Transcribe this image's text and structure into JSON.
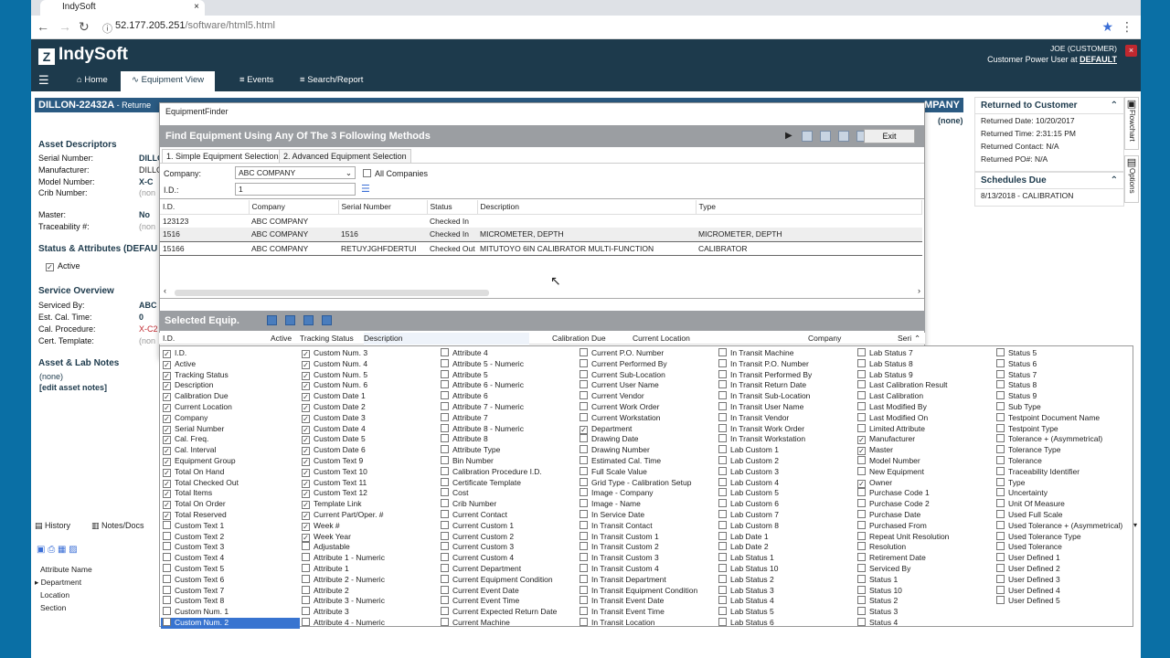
{
  "browser": {
    "tab_title": "IndySoft",
    "tab_close": "×",
    "url_host": "52.177.205.251",
    "url_path": "/software/html5.html"
  },
  "app": {
    "logo": "IndySoft",
    "user_name": "JOE (CUSTOMER)",
    "user_role": "Customer Power User at",
    "user_org": "DEFAULT",
    "close": "×"
  },
  "nav": [
    {
      "label": "Home"
    },
    {
      "label": "Equipment View"
    },
    {
      "label": "Events"
    },
    {
      "label": "Search/Report"
    }
  ],
  "banner": {
    "title": "DILLON-22432A",
    "sub": " - Returne",
    "right": "MPANY",
    "none": "(none)"
  },
  "left": {
    "asset_descriptors": "Asset Descriptors",
    "serial_lbl": "Serial Number:",
    "serial_val": "DILLO",
    "manufacturer_lbl": "Manufacturer:",
    "manufacturer_val": "DILLO",
    "model_lbl": "Model Number:",
    "model_val": "X-C",
    "crib_lbl": "Crib Number:",
    "crib_val": "(non",
    "master_lbl": "Master:",
    "master_val": "No",
    "trace_lbl": "Traceability #:",
    "trace_val": "(non",
    "status_sect": "Status & Attributes (DEFAU",
    "active": "Active",
    "service_sect": "Service Overview",
    "serviced_lbl": "Serviced By:",
    "serviced_val": "ABC",
    "estcal_lbl": "Est. Cal. Time:",
    "estcal_val": "0",
    "calproc_lbl": "Cal. Procedure:",
    "calproc_val": "X-C2",
    "cert_lbl": "Cert. Template:",
    "cert_val": "(non",
    "notes_sect": "Asset & Lab Notes",
    "notes_none": "(none)",
    "edit_notes": "[edit asset notes]",
    "history": "History",
    "notes_docs": "Notes/Docs",
    "attr_name": "Attribute Name",
    "attrs": [
      "Department",
      "Location",
      "Section"
    ]
  },
  "right": {
    "returned_hd": "Returned to Customer",
    "returned_rows": [
      "Returned Date:  10/20/2017",
      "Returned Time:  2:31:15 PM",
      "Returned Contact:  N/A",
      "Returned PO#:  N/A"
    ],
    "sched_hd": "Schedules Due",
    "sched_rows": [
      "8/13/2018 - CALIBRATION"
    ],
    "flowchart": "Flowchart",
    "options": "Options"
  },
  "dialog": {
    "title": "EquipmentFinder",
    "bar": "Find Equipment Using Any Of The 3 Following Methods",
    "exit": "Exit",
    "tab1": "1. Simple Equipment Selection",
    "tab2": "2. Advanced Equipment Selection",
    "company_lbl": "Company:",
    "company_val": "ABC COMPANY",
    "all_companies": "All Companies",
    "id_lbl": "I.D.:",
    "id_val": "1",
    "headers": [
      "I.D.",
      "Company",
      "Serial Number",
      "Status",
      "Description",
      "Type"
    ],
    "rows": [
      [
        "123123",
        "ABC COMPANY",
        "",
        "Checked In",
        "",
        ""
      ],
      [
        "1516",
        "ABC COMPANY",
        "1516",
        "Checked In",
        "MICROMETER, DEPTH",
        "MICROMETER, DEPTH"
      ],
      [
        "15166",
        "ABC COMPANY",
        "RETUYJGHFDERTUI",
        "Checked Out",
        "MITUTOYO 6IN CALIBRATOR MULTI-FUNCTION",
        "CALIBRATOR"
      ]
    ]
  },
  "selected": {
    "title": "Selected Equip.",
    "headers": [
      "I.D.",
      "Active",
      "Tracking Status",
      "Description",
      "Calibration Due",
      "Current Location",
      "Company",
      "Seri"
    ]
  },
  "columns": [
    [
      [
        "I.D.",
        1
      ],
      [
        "Active",
        1
      ],
      [
        "Tracking Status",
        1
      ],
      [
        "Description",
        1
      ],
      [
        "Calibration Due",
        1
      ],
      [
        "Current Location",
        1
      ],
      [
        "Company",
        1
      ],
      [
        "Serial Number",
        1
      ],
      [
        "Cal. Freq.",
        1
      ],
      [
        "Cal. Interval",
        1
      ],
      [
        "Equipment Group",
        1
      ],
      [
        "Total On Hand",
        1
      ],
      [
        "Total Checked Out",
        1
      ],
      [
        "Total Items",
        1
      ],
      [
        "Total On Order",
        1
      ],
      [
        "Total Reserved",
        1
      ],
      [
        "Custom Text 1",
        0
      ],
      [
        "Custom Text 2",
        0
      ],
      [
        "Custom Text 3",
        0
      ],
      [
        "Custom Text 4",
        0
      ],
      [
        "Custom Text 5",
        0
      ],
      [
        "Custom Text 6",
        0
      ],
      [
        "Custom Text 7",
        0
      ],
      [
        "Custom Text 8",
        0
      ],
      [
        "Custom Num. 1",
        0
      ],
      [
        "Custom Num. 2",
        0
      ]
    ],
    [
      [
        "Custom Num. 3",
        1
      ],
      [
        "Custom Num. 4",
        1
      ],
      [
        "Custom Num. 5",
        1
      ],
      [
        "Custom Num. 6",
        1
      ],
      [
        "Custom Date 1",
        1
      ],
      [
        "Custom Date 2",
        1
      ],
      [
        "Custom Date 3",
        1
      ],
      [
        "Custom Date 4",
        1
      ],
      [
        "Custom Date 5",
        1
      ],
      [
        "Custom Date 6",
        1
      ],
      [
        "Custom Text 9",
        1
      ],
      [
        "Custom Text 10",
        1
      ],
      [
        "Custom Text 11",
        1
      ],
      [
        "Custom Text 12",
        1
      ],
      [
        "Template Link",
        1
      ],
      [
        "Current Part/Oper. #",
        1
      ],
      [
        "Week #",
        1
      ],
      [
        "Week Year",
        1
      ],
      [
        "Adjustable",
        0
      ],
      [
        "Attribute 1 - Numeric",
        0
      ],
      [
        "Attribute 1",
        0
      ],
      [
        "Attribute 2 - Numeric",
        0
      ],
      [
        "Attribute 2",
        0
      ],
      [
        "Attribute 3 - Numeric",
        0
      ],
      [
        "Attribute 3",
        0
      ],
      [
        "Attribute 4 - Numeric",
        0
      ]
    ],
    [
      [
        "Attribute 4",
        0
      ],
      [
        "Attribute 5 - Numeric",
        0
      ],
      [
        "Attribute 5",
        0
      ],
      [
        "Attribute 6 - Numeric",
        0
      ],
      [
        "Attribute 6",
        0
      ],
      [
        "Attribute 7 - Numeric",
        0
      ],
      [
        "Attribute 7",
        0
      ],
      [
        "Attribute 8 - Numeric",
        0
      ],
      [
        "Attribute 8",
        0
      ],
      [
        "Attribute Type",
        0
      ],
      [
        "Bin Number",
        0
      ],
      [
        "Calibration Procedure I.D.",
        0
      ],
      [
        "Certificate Template",
        0
      ],
      [
        "Cost",
        0
      ],
      [
        "Crib Number",
        0
      ],
      [
        "Current Contact",
        0
      ],
      [
        "Current Custom 1",
        0
      ],
      [
        "Current Custom 2",
        0
      ],
      [
        "Current Custom 3",
        0
      ],
      [
        "Current Custom 4",
        0
      ],
      [
        "Current Department",
        0
      ],
      [
        "Current Equipment Condition",
        0
      ],
      [
        "Current Event Date",
        0
      ],
      [
        "Current Event Time",
        0
      ],
      [
        "Current Expected Return Date",
        0
      ],
      [
        "Current Machine",
        0
      ]
    ],
    [
      [
        "Current P.O. Number",
        0
      ],
      [
        "Current Performed By",
        0
      ],
      [
        "Current Sub-Location",
        0
      ],
      [
        "Current User Name",
        0
      ],
      [
        "Current Vendor",
        0
      ],
      [
        "Current Work Order",
        0
      ],
      [
        "Current Workstation",
        0
      ],
      [
        "Department",
        1
      ],
      [
        "Drawing Date",
        0
      ],
      [
        "Drawing Number",
        0
      ],
      [
        "Estimated Cal. Time",
        0
      ],
      [
        "Full Scale Value",
        0
      ],
      [
        "Grid Type - Calibration Setup",
        0
      ],
      [
        "Image - Company",
        0
      ],
      [
        "Image - Name",
        0
      ],
      [
        "In Service Date",
        0
      ],
      [
        "In Transit Contact",
        0
      ],
      [
        "In Transit Custom 1",
        0
      ],
      [
        "In Transit Custom 2",
        0
      ],
      [
        "In Transit Custom 3",
        0
      ],
      [
        "In Transit Custom 4",
        0
      ],
      [
        "In Transit Department",
        0
      ],
      [
        "In Transit Equipment Condition",
        0
      ],
      [
        "In Transit Event Date",
        0
      ],
      [
        "In Transit Event Time",
        0
      ],
      [
        "In Transit Location",
        0
      ]
    ],
    [
      [
        "In Transit Machine",
        0
      ],
      [
        "In Transit P.O. Number",
        0
      ],
      [
        "In Transit Performed By",
        0
      ],
      [
        "In Transit Return Date",
        0
      ],
      [
        "In Transit Sub-Location",
        0
      ],
      [
        "In Transit User Name",
        0
      ],
      [
        "In Transit Vendor",
        0
      ],
      [
        "In Transit Work Order",
        0
      ],
      [
        "In Transit Workstation",
        0
      ],
      [
        "Lab Custom 1",
        0
      ],
      [
        "Lab Custom 2",
        0
      ],
      [
        "Lab Custom 3",
        0
      ],
      [
        "Lab Custom 4",
        0
      ],
      [
        "Lab Custom 5",
        0
      ],
      [
        "Lab Custom 6",
        0
      ],
      [
        "Lab Custom 7",
        0
      ],
      [
        "Lab Custom 8",
        0
      ],
      [
        "Lab Date 1",
        0
      ],
      [
        "Lab Date 2",
        0
      ],
      [
        "Lab Status 1",
        0
      ],
      [
        "Lab Status 10",
        0
      ],
      [
        "Lab Status 2",
        0
      ],
      [
        "Lab Status 3",
        0
      ],
      [
        "Lab Status 4",
        0
      ],
      [
        "Lab Status 5",
        0
      ],
      [
        "Lab Status 6",
        0
      ]
    ],
    [
      [
        "Lab Status 7",
        0
      ],
      [
        "Lab Status 8",
        0
      ],
      [
        "Lab Status 9",
        0
      ],
      [
        "Last Calibration Result",
        0
      ],
      [
        "Last Calibration",
        0
      ],
      [
        "Last Modified By",
        0
      ],
      [
        "Last Modified On",
        0
      ],
      [
        "Limited Attribute",
        0
      ],
      [
        "Manufacturer",
        1
      ],
      [
        "Master",
        1
      ],
      [
        "Model Number",
        0
      ],
      [
        "New Equipment",
        0
      ],
      [
        "Owner",
        1
      ],
      [
        "Purchase Code 1",
        0
      ],
      [
        "Purchase Code 2",
        0
      ],
      [
        "Purchase Date",
        0
      ],
      [
        "Purchased From",
        0
      ],
      [
        "Repeat Unit Resolution",
        0
      ],
      [
        "Resolution",
        0
      ],
      [
        "Retirement Date",
        0
      ],
      [
        "Serviced By",
        0
      ],
      [
        "Status 1",
        0
      ],
      [
        "Status 10",
        0
      ],
      [
        "Status 2",
        0
      ],
      [
        "Status 3",
        0
      ],
      [
        "Status 4",
        0
      ]
    ],
    [
      [
        "Status 5",
        0
      ],
      [
        "Status 6",
        0
      ],
      [
        "Status 7",
        0
      ],
      [
        "Status 8",
        0
      ],
      [
        "Status 9",
        0
      ],
      [
        "Sub Type",
        0
      ],
      [
        "Testpoint Document Name",
        0
      ],
      [
        "Testpoint Type",
        0
      ],
      [
        "Tolerance + (Asymmetrical)",
        0
      ],
      [
        "Tolerance Type",
        0
      ],
      [
        "Tolerance",
        0
      ],
      [
        "Traceability Identifier",
        0
      ],
      [
        "Type",
        0
      ],
      [
        "Uncertainty",
        0
      ],
      [
        "Unit Of Measure",
        0
      ],
      [
        "Used Full Scale",
        0
      ],
      [
        "Used Tolerance + (Asymmetrical)",
        0
      ],
      [
        "Used Tolerance Type",
        0
      ],
      [
        "Used Tolerance",
        0
      ],
      [
        "User Defined 1",
        0
      ],
      [
        "User Defined 2",
        0
      ],
      [
        "User Defined 3",
        0
      ],
      [
        "User Defined 4",
        0
      ],
      [
        "User Defined 5",
        0
      ]
    ]
  ],
  "highlighted": "Custom Num. 2",
  "colors": {
    "header": "#1d3a4c",
    "banner": "#2a5a82",
    "bar": "#9b9ea2",
    "highlight": "#3874d0"
  }
}
